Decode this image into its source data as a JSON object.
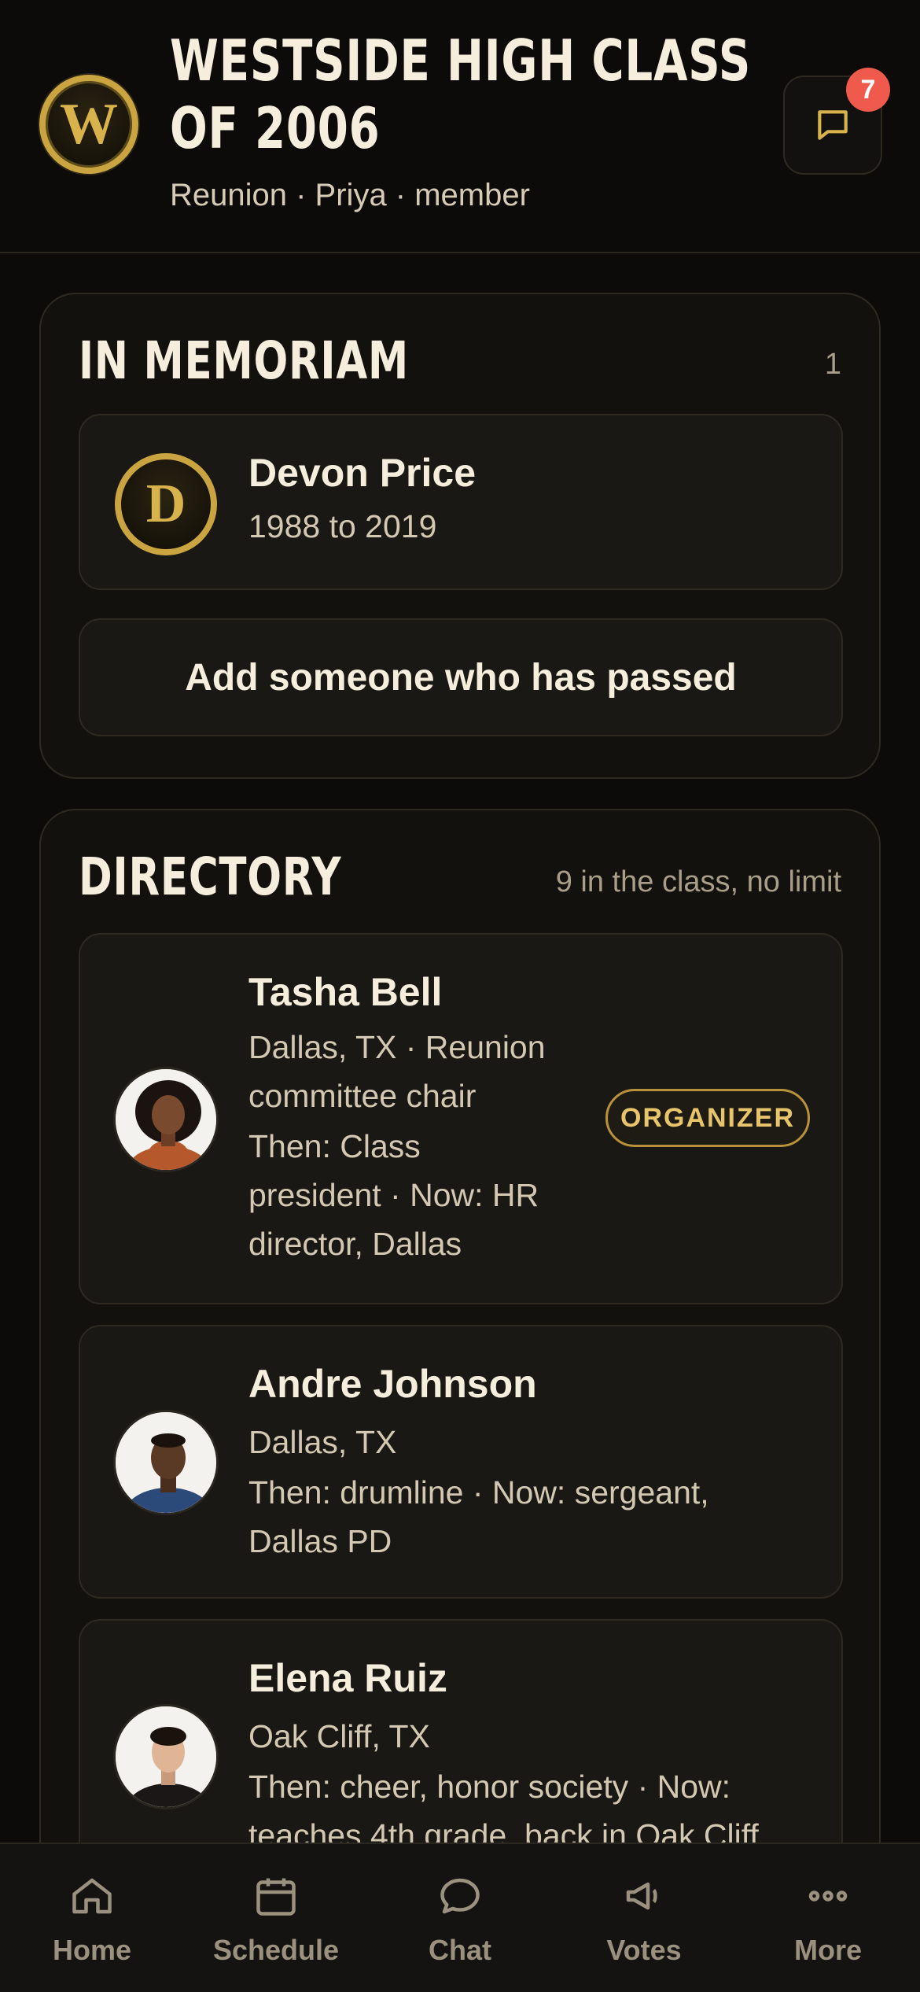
{
  "header": {
    "title": "WESTSIDE HIGH CLASS OF 2006",
    "subtitle": "Reunion · Priya · member",
    "crest_letter": "W",
    "chat_icon": "message-square-icon",
    "notification_count": "7"
  },
  "memoriam": {
    "title": "IN MEMORIAM",
    "count": "1",
    "items": [
      {
        "letter": "D",
        "name": "Devon Price",
        "years": "1988 to 2019"
      }
    ],
    "add_label": "Add someone who has passed"
  },
  "directory": {
    "title": "DIRECTORY",
    "meta": "9 in the class, no limit",
    "members": [
      {
        "name": "Tasha Bell",
        "line1": "Dallas, TX · Reunion",
        "line2": "committee chair",
        "line3": "Then: Class",
        "line4": "president · Now: HR",
        "line5": "director, Dallas",
        "badge": "ORGANIZER"
      },
      {
        "name": "Andre Johnson",
        "line1": "Dallas, TX",
        "line2": "Then: drumline · Now: sergeant,",
        "line3": "Dallas PD"
      },
      {
        "name": "Elena Ruiz",
        "line1": "Oak Cliff, TX",
        "line2": "Then: cheer, honor society · Now:",
        "line3": "teaches 4th grade, back in Oak Cliff"
      }
    ]
  },
  "tabs": [
    {
      "label": "Home",
      "icon": "home-icon"
    },
    {
      "label": "Schedule",
      "icon": "calendar-icon"
    },
    {
      "label": "Chat",
      "icon": "chat-bubble-icon"
    },
    {
      "label": "Votes",
      "icon": "megaphone-icon"
    },
    {
      "label": "More",
      "icon": "more-dots-icon"
    }
  ],
  "colors": {
    "background": "#0c0b09",
    "card": "#12110e",
    "gold": "#c9a441",
    "badge": "#ef5a4c",
    "text": "#f6eedc"
  }
}
